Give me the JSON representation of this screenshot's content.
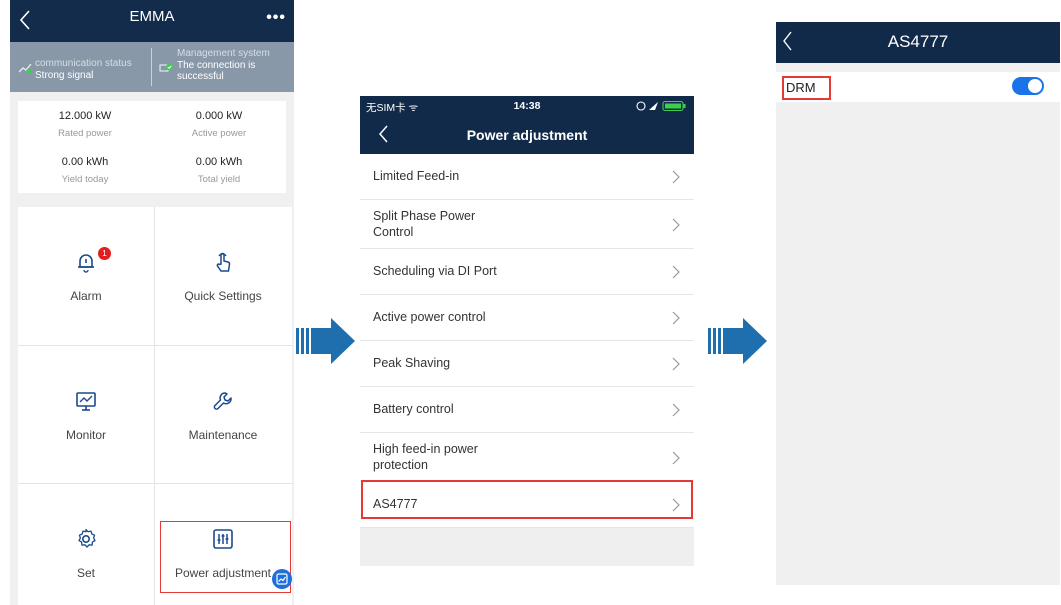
{
  "screen1": {
    "title": "EMMA",
    "more_label": "•••",
    "comm_status_label": "communication status",
    "comm_status_value": "Strong signal",
    "mgmt_label": "Management system",
    "mgmt_value_line1": "The connection is",
    "mgmt_value_line2": "successful",
    "kpis": [
      {
        "value": "12.000 kW",
        "label": "Rated power"
      },
      {
        "value": "0.000 kW",
        "label": "Active power"
      },
      {
        "value": "0.00 kWh",
        "label": "Yield today"
      },
      {
        "value": "0.00 kWh",
        "label": "Total yield"
      }
    ],
    "tiles": [
      {
        "label": "Alarm",
        "icon": "bell-icon",
        "badge": "1"
      },
      {
        "label": "Quick Settings",
        "icon": "hand-pointer-icon"
      },
      {
        "label": "Monitor",
        "icon": "monitor-icon"
      },
      {
        "label": "Maintenance",
        "icon": "wrench-icon"
      },
      {
        "label": "Set",
        "icon": "gear-icon"
      },
      {
        "label": "Power adjustment",
        "icon": "sliders-icon"
      }
    ],
    "colors": {
      "header": "#142c4c",
      "status_bar": "#8898a8",
      "highlight": "#e53935"
    }
  },
  "screen2": {
    "carrier": "无SIM卡 ᯤ",
    "time": "14:38",
    "title": "Power adjustment",
    "items": [
      {
        "line1": "Limited Feed-in",
        "line2": ""
      },
      {
        "line1": "Split Phase Power",
        "line2": "Control"
      },
      {
        "line1": "Scheduling via DI Port",
        "line2": ""
      },
      {
        "line1": "Active power control",
        "line2": ""
      },
      {
        "line1": "Peak Shaving",
        "line2": ""
      },
      {
        "line1": "Battery control",
        "line2": ""
      },
      {
        "line1": "High feed-in power",
        "line2": "protection"
      },
      {
        "line1": "AS4777",
        "line2": ""
      }
    ],
    "highlighted_item": "AS4777"
  },
  "screen3": {
    "title": "AS4777",
    "setting_label": "DRM",
    "toggle_on": true,
    "colors": {
      "toggle": "#1a73e8"
    }
  },
  "arrow_color": "#1f6fae"
}
